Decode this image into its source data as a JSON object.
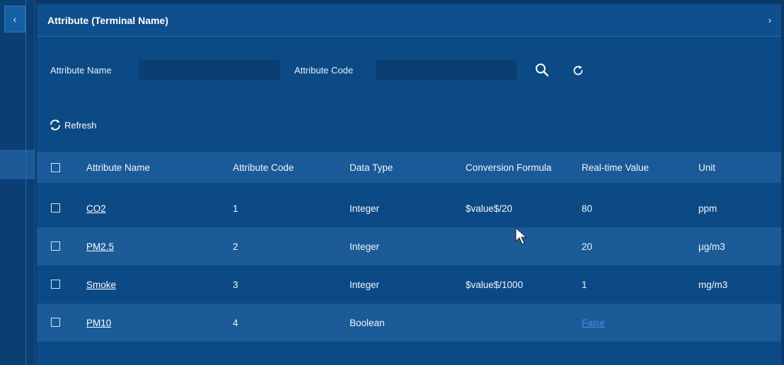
{
  "panel": {
    "title": "Attribute (Terminal Name)"
  },
  "filters": {
    "name_label": "Attribute Name",
    "name_value": "",
    "code_label": "Attribute Code",
    "code_value": "",
    "search_icon": "search-icon",
    "reset_icon": "reset-icon"
  },
  "toolbar": {
    "refresh_label": "Refresh"
  },
  "table": {
    "headers": [
      "Attribute Name",
      "Attribute Code",
      "Data Type",
      "Conversion Formula",
      "Real-time Value",
      "Unit"
    ],
    "rows": [
      {
        "name": "CO2",
        "code": "1",
        "type": "Integer",
        "formula": "$value$/20",
        "value": "80",
        "unit": "ppm"
      },
      {
        "name": "PM2.5",
        "code": "2",
        "type": "Integer",
        "formula": "",
        "value": "20",
        "unit": "µg/m3"
      },
      {
        "name": "Smoke",
        "code": "3",
        "type": "Integer",
        "formula": "$value$/1000",
        "value": "1",
        "unit": "mg/m3"
      },
      {
        "name": "PM10",
        "code": "4",
        "type": "Boolean",
        "formula": "",
        "value": "False",
        "unit": ""
      }
    ]
  },
  "colors": {
    "background": "#0c4a85",
    "header_row": "#1a5a98",
    "alt_row": "#1a5b98",
    "link_blue": "#3e8fe6"
  }
}
